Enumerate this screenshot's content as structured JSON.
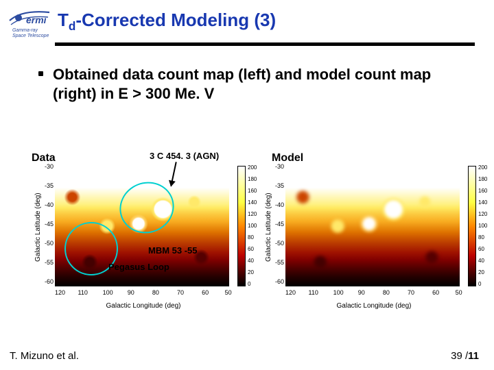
{
  "header": {
    "logo_lines": [
      "Gamma-ray",
      "Space Telescope"
    ],
    "title_pre": "T",
    "title_sub": "d",
    "title_post": "-Corrected Modeling (3)"
  },
  "bullet": "Obtained data count map (left) and model count map (right) in E > 300 Me. V",
  "labels": {
    "data": "Data",
    "model": "Model"
  },
  "annotations": {
    "agn": "3 C 454. 3 (AGN)",
    "mbm": "MBM 53 -55",
    "pegasus": "Pegasus Loop"
  },
  "axes": {
    "xlabel": "Galactic Longitude (deg)",
    "ylabel": "Galactic Latitude (deg)",
    "xticks": [
      "120",
      "110",
      "100",
      "90",
      "80",
      "70",
      "60",
      "50"
    ],
    "yticks": [
      "-30",
      "-35",
      "-40",
      "-45",
      "-50",
      "-55",
      "-60"
    ]
  },
  "colorbars": {
    "left": [
      "200",
      "180",
      "160",
      "140",
      "120",
      "100",
      "80",
      "60",
      "40",
      "20",
      "0"
    ],
    "right": [
      "200",
      "180",
      "160",
      "140",
      "120",
      "100",
      "80",
      "60",
      "40",
      "20",
      "0"
    ]
  },
  "footer": "T. Mizuno et al.",
  "page": {
    "current": "39",
    "sep": " /",
    "total": "11"
  },
  "chart_data": [
    {
      "type": "heatmap",
      "title": "Data",
      "xlabel": "Galactic Longitude (deg)",
      "ylabel": "Galactic Latitude (deg)",
      "xlim": [
        120,
        50
      ],
      "ylim": [
        -60,
        -30
      ],
      "color_range": [
        0,
        200
      ],
      "annotations": [
        {
          "name": "3 C 454.3 (AGN)",
          "approx_lon": 86,
          "approx_lat": -38
        },
        {
          "name": "MBM 53-55",
          "approx_lon": 92,
          "approx_lat": -40
        },
        {
          "name": "Pegasus Loop",
          "approx_lon": 107,
          "approx_lat": -50
        }
      ]
    },
    {
      "type": "heatmap",
      "title": "Model",
      "xlabel": "Galactic Longitude (deg)",
      "ylabel": "Galactic Latitude (deg)",
      "xlim": [
        120,
        50
      ],
      "ylim": [
        -60,
        -30
      ],
      "color_range": [
        0,
        200
      ]
    }
  ]
}
